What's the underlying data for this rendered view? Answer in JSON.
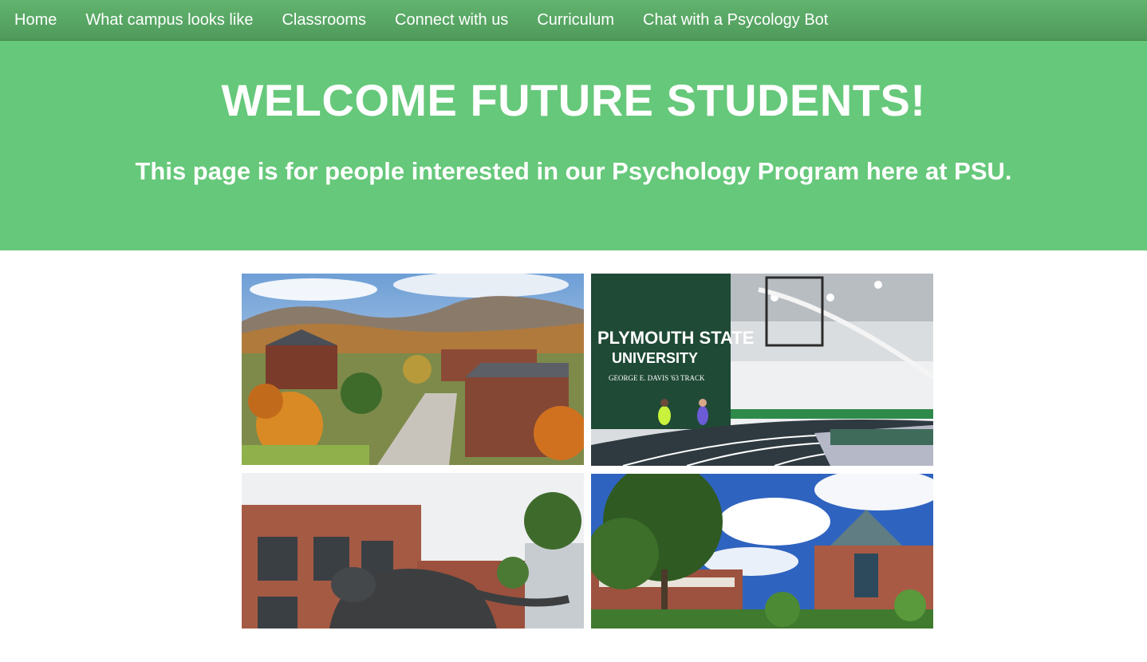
{
  "nav": {
    "items": [
      {
        "label": "Home"
      },
      {
        "label": "What campus looks like"
      },
      {
        "label": "Classrooms"
      },
      {
        "label": "Connect with us"
      },
      {
        "label": "Curriculum"
      },
      {
        "label": "Chat with a Psycology Bot"
      }
    ]
  },
  "hero": {
    "title": "WELCOME FUTURE STUDENTS!",
    "subtitle": "This page is for people interested in our Psychology Program here at PSU."
  },
  "gallery": {
    "photo2_sign_line1": "PLYMOUTH STATE",
    "photo2_sign_line2": "UNIVERSITY",
    "photo2_sign_line3": "GEORGE E. DAVIS '63 TRACK"
  },
  "colors": {
    "nav_bg": "#5aa866",
    "hero_bg": "#66c87a",
    "text": "#ffffff"
  }
}
